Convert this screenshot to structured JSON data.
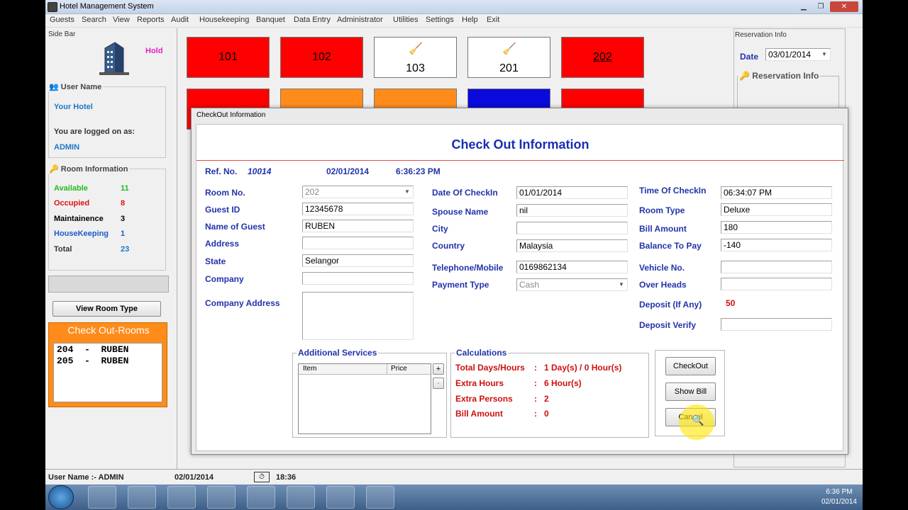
{
  "window": {
    "title": "Hotel Management System"
  },
  "menu": [
    "Guests",
    "Search",
    "View",
    "Reports",
    "Audit",
    "Housekeeping",
    "Banquet",
    "Data Entry",
    "Administrator",
    "Utilities",
    "Settings",
    "Help",
    "Exit"
  ],
  "sidebar": {
    "title": "Side Bar",
    "hold_label": "Hold",
    "user_group_label": "User Name",
    "hotel_name": "Your Hotel",
    "logged_on_label": "You are logged on as:",
    "user": "ADMIN",
    "room_info_label": "Room Information",
    "room_info": [
      {
        "label": "Available",
        "count": "11",
        "label_color": "#22bb22",
        "count_color": "#22bb22"
      },
      {
        "label": "Occupied",
        "count": "8",
        "label_color": "#e01111",
        "count_color": "#e01111"
      },
      {
        "label": "Maintainence",
        "count": "3",
        "label_color": "#000000",
        "count_color": "#000000"
      },
      {
        "label": "HouseKeeping",
        "count": "1",
        "label_color": "#1c5bc9",
        "count_color": "#1c5bc9"
      },
      {
        "label": "Total",
        "count": "23",
        "label_color": "#333333",
        "count_color": "#1c77c9"
      }
    ],
    "view_room_type_button": "View Room Type",
    "checkout_rooms_title": "Check Out-Rooms",
    "checkout_rooms": [
      {
        "room": "204",
        "sep": "-",
        "guest": "RUBEN"
      },
      {
        "room": "205",
        "sep": "-",
        "guest": "RUBEN"
      }
    ]
  },
  "rooms_row1": [
    {
      "number": "101",
      "state": "red"
    },
    {
      "number": "102",
      "state": "red"
    },
    {
      "number": "103",
      "state": "white"
    },
    {
      "number": "201",
      "state": "white"
    },
    {
      "number": "202",
      "state": "red"
    }
  ],
  "rooms_row2_colors": [
    "#ff0000",
    "#ff8c1a",
    "#ff8c1a",
    "#0a0adc",
    "#ff0000"
  ],
  "reservation": {
    "title": "Reservation Info",
    "date_label": "Date",
    "date_value": "03/01/2014",
    "group_label": "Reservation Info"
  },
  "statusbar": {
    "user": "User Name :- ADMIN",
    "date": "02/01/2014",
    "time": "18:36"
  },
  "taskbar": {
    "time": "6:36 PM",
    "date": "02/01/2014"
  },
  "dialog": {
    "window_title": "CheckOut Information",
    "heading": "Check Out Information",
    "ref_label": "Ref. No.",
    "ref_no": "10014",
    "ref_date": "02/01/2014",
    "ref_time": "6:36:23 PM",
    "col1": [
      {
        "label": "Room No.",
        "value": "202",
        "disabled": true,
        "combo": true
      },
      {
        "label": "Guest ID",
        "value": "12345678"
      },
      {
        "label": "Name of Guest",
        "value": "RUBEN"
      },
      {
        "label": "Address",
        "value": ""
      },
      {
        "label": "State",
        "value": "Selangor"
      },
      {
        "label": "Company",
        "value": ""
      },
      {
        "label": "Company Address",
        "value": ""
      }
    ],
    "col2": [
      {
        "label": "Date Of CheckIn",
        "value": "01/01/2014"
      },
      {
        "label": "Spouse Name",
        "value": "nil"
      },
      {
        "label": "City",
        "value": ""
      },
      {
        "label": "Country",
        "value": "Malaysia"
      },
      {
        "label": "Telephone/Mobile",
        "value": "0169862134"
      },
      {
        "label": "Payment Type",
        "value": "Cash",
        "disabled": true,
        "combo": true
      }
    ],
    "col3": [
      {
        "label": "Time Of CheckIn",
        "value": "06:34:07 PM"
      },
      {
        "label": "Room Type",
        "value": "Deluxe"
      },
      {
        "label": "Bill Amount",
        "value": "180"
      },
      {
        "label": "Balance To Pay",
        "value": "-140"
      },
      {
        "label": "Vehicle No.",
        "value": ""
      },
      {
        "label": "Over Heads",
        "value": ""
      },
      {
        "label": "Deposit (If Any)",
        "value": "50"
      },
      {
        "label": "Deposit Verify",
        "value": ""
      }
    ],
    "additional_services": {
      "title": "Additional Services",
      "col_item": "Item",
      "col_price": "Price",
      "add": "+",
      "remove": "-"
    },
    "calculations": {
      "title": "Calculations",
      "rows": [
        {
          "label": "Total Days/Hours",
          "sep": ":",
          "value": "1 Day(s) / 0 Hour(s)"
        },
        {
          "label": "Extra Hours",
          "sep": ":",
          "value": "6 Hour(s)"
        },
        {
          "label": "Extra Persons",
          "sep": ":",
          "value": "2"
        },
        {
          "label": "Bill Amount",
          "sep": ":",
          "value": "0"
        }
      ]
    },
    "buttons": {
      "checkout": "CheckOut",
      "show_bill": "Show Bill",
      "cancel": "Cancel"
    }
  }
}
